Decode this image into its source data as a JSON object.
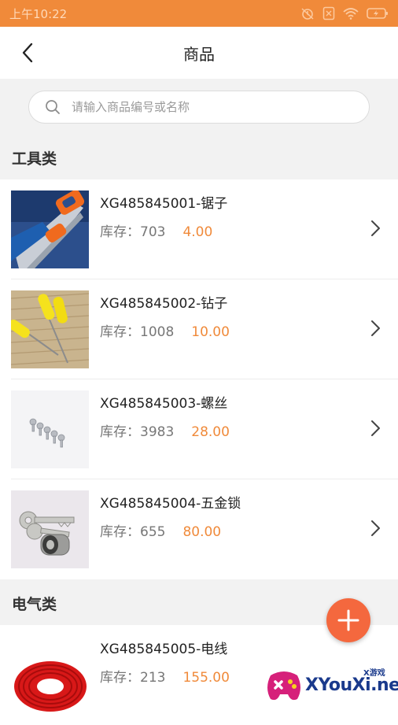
{
  "status_bar": {
    "time": "上午10:22"
  },
  "nav": {
    "title": "商品",
    "back_icon": "chevron-left-icon"
  },
  "search": {
    "placeholder": "请输入商品编号或名称",
    "value": "",
    "icon": "search-icon"
  },
  "categories": [
    {
      "name": "工具类",
      "products": [
        {
          "name": "XG485845001-锯子",
          "stock_label": "库存：",
          "stock": "703",
          "price": "4.00",
          "image": "saw"
        },
        {
          "name": "XG485845002-钻子",
          "stock_label": "库存：",
          "stock": "1008",
          "price": "10.00",
          "image": "awl"
        },
        {
          "name": "XG485845003-螺丝",
          "stock_label": "库存：",
          "stock": "3983",
          "price": "28.00",
          "image": "screws"
        },
        {
          "name": "XG485845004-五金锁",
          "stock_label": "库存：",
          "stock": "655",
          "price": "80.00",
          "image": "lock"
        }
      ]
    },
    {
      "name": "电气类",
      "products": [
        {
          "name": "XG485845005-电线",
          "stock_label": "库存：",
          "stock": "213",
          "price": "155.00",
          "image": "wire"
        }
      ]
    }
  ],
  "fab": {
    "icon": "plus-icon"
  },
  "watermark": {
    "brand": "XYouXi.net",
    "small": "X游戏"
  },
  "colors": {
    "status_bar": "#f08a3a",
    "accent_price": "#f08a3a",
    "fab": "#f4683e",
    "background": "#f2f2f2"
  }
}
